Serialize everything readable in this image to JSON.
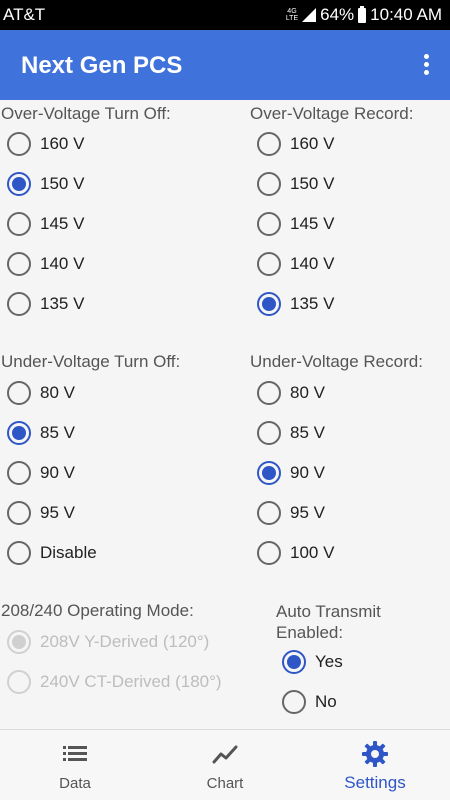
{
  "status_bar": {
    "carrier": "AT&T",
    "network": "4G LTE",
    "battery": "64%",
    "time": "10:40 AM"
  },
  "app_bar": {
    "title": "Next Gen PCS"
  },
  "over_voltage_turn_off": {
    "label": "Over-Voltage Turn Off:",
    "options": [
      "160 V",
      "150 V",
      "145 V",
      "140 V",
      "135 V"
    ],
    "selected": "150 V"
  },
  "over_voltage_record": {
    "label": "Over-Voltage Record:",
    "options": [
      "160 V",
      "150 V",
      "145 V",
      "140 V",
      "135 V"
    ],
    "selected": "135 V"
  },
  "under_voltage_turn_off": {
    "label": "Under-Voltage Turn Off:",
    "options": [
      "80 V",
      "85 V",
      "90 V",
      "95 V",
      "Disable"
    ],
    "selected": "85 V"
  },
  "under_voltage_record": {
    "label": "Under-Voltage Record:",
    "options": [
      "80 V",
      "85 V",
      "90 V",
      "95 V",
      "100 V"
    ],
    "selected": "90 V"
  },
  "operating_mode": {
    "label": "208/240 Operating Mode:",
    "options": [
      "208V Y-Derived (120°)",
      "240V CT-Derived (180°)"
    ],
    "selected": "208V Y-Derived (120°)",
    "disabled": true
  },
  "auto_transmit": {
    "label_line1": "Auto Transmit",
    "label_line2": "Enabled:",
    "options": [
      "Yes",
      "No"
    ],
    "selected": "Yes"
  },
  "bottom_nav": {
    "items": [
      {
        "label": "Data",
        "icon": "list-icon",
        "active": false
      },
      {
        "label": "Chart",
        "icon": "trend-chart-icon",
        "active": false
      },
      {
        "label": "Settings",
        "icon": "gear-icon",
        "active": true
      }
    ]
  },
  "colors": {
    "primary": "#3f73db",
    "accent": "#2e56c7",
    "disabled": "#d0d0d0",
    "background": "#f5f5f5"
  }
}
